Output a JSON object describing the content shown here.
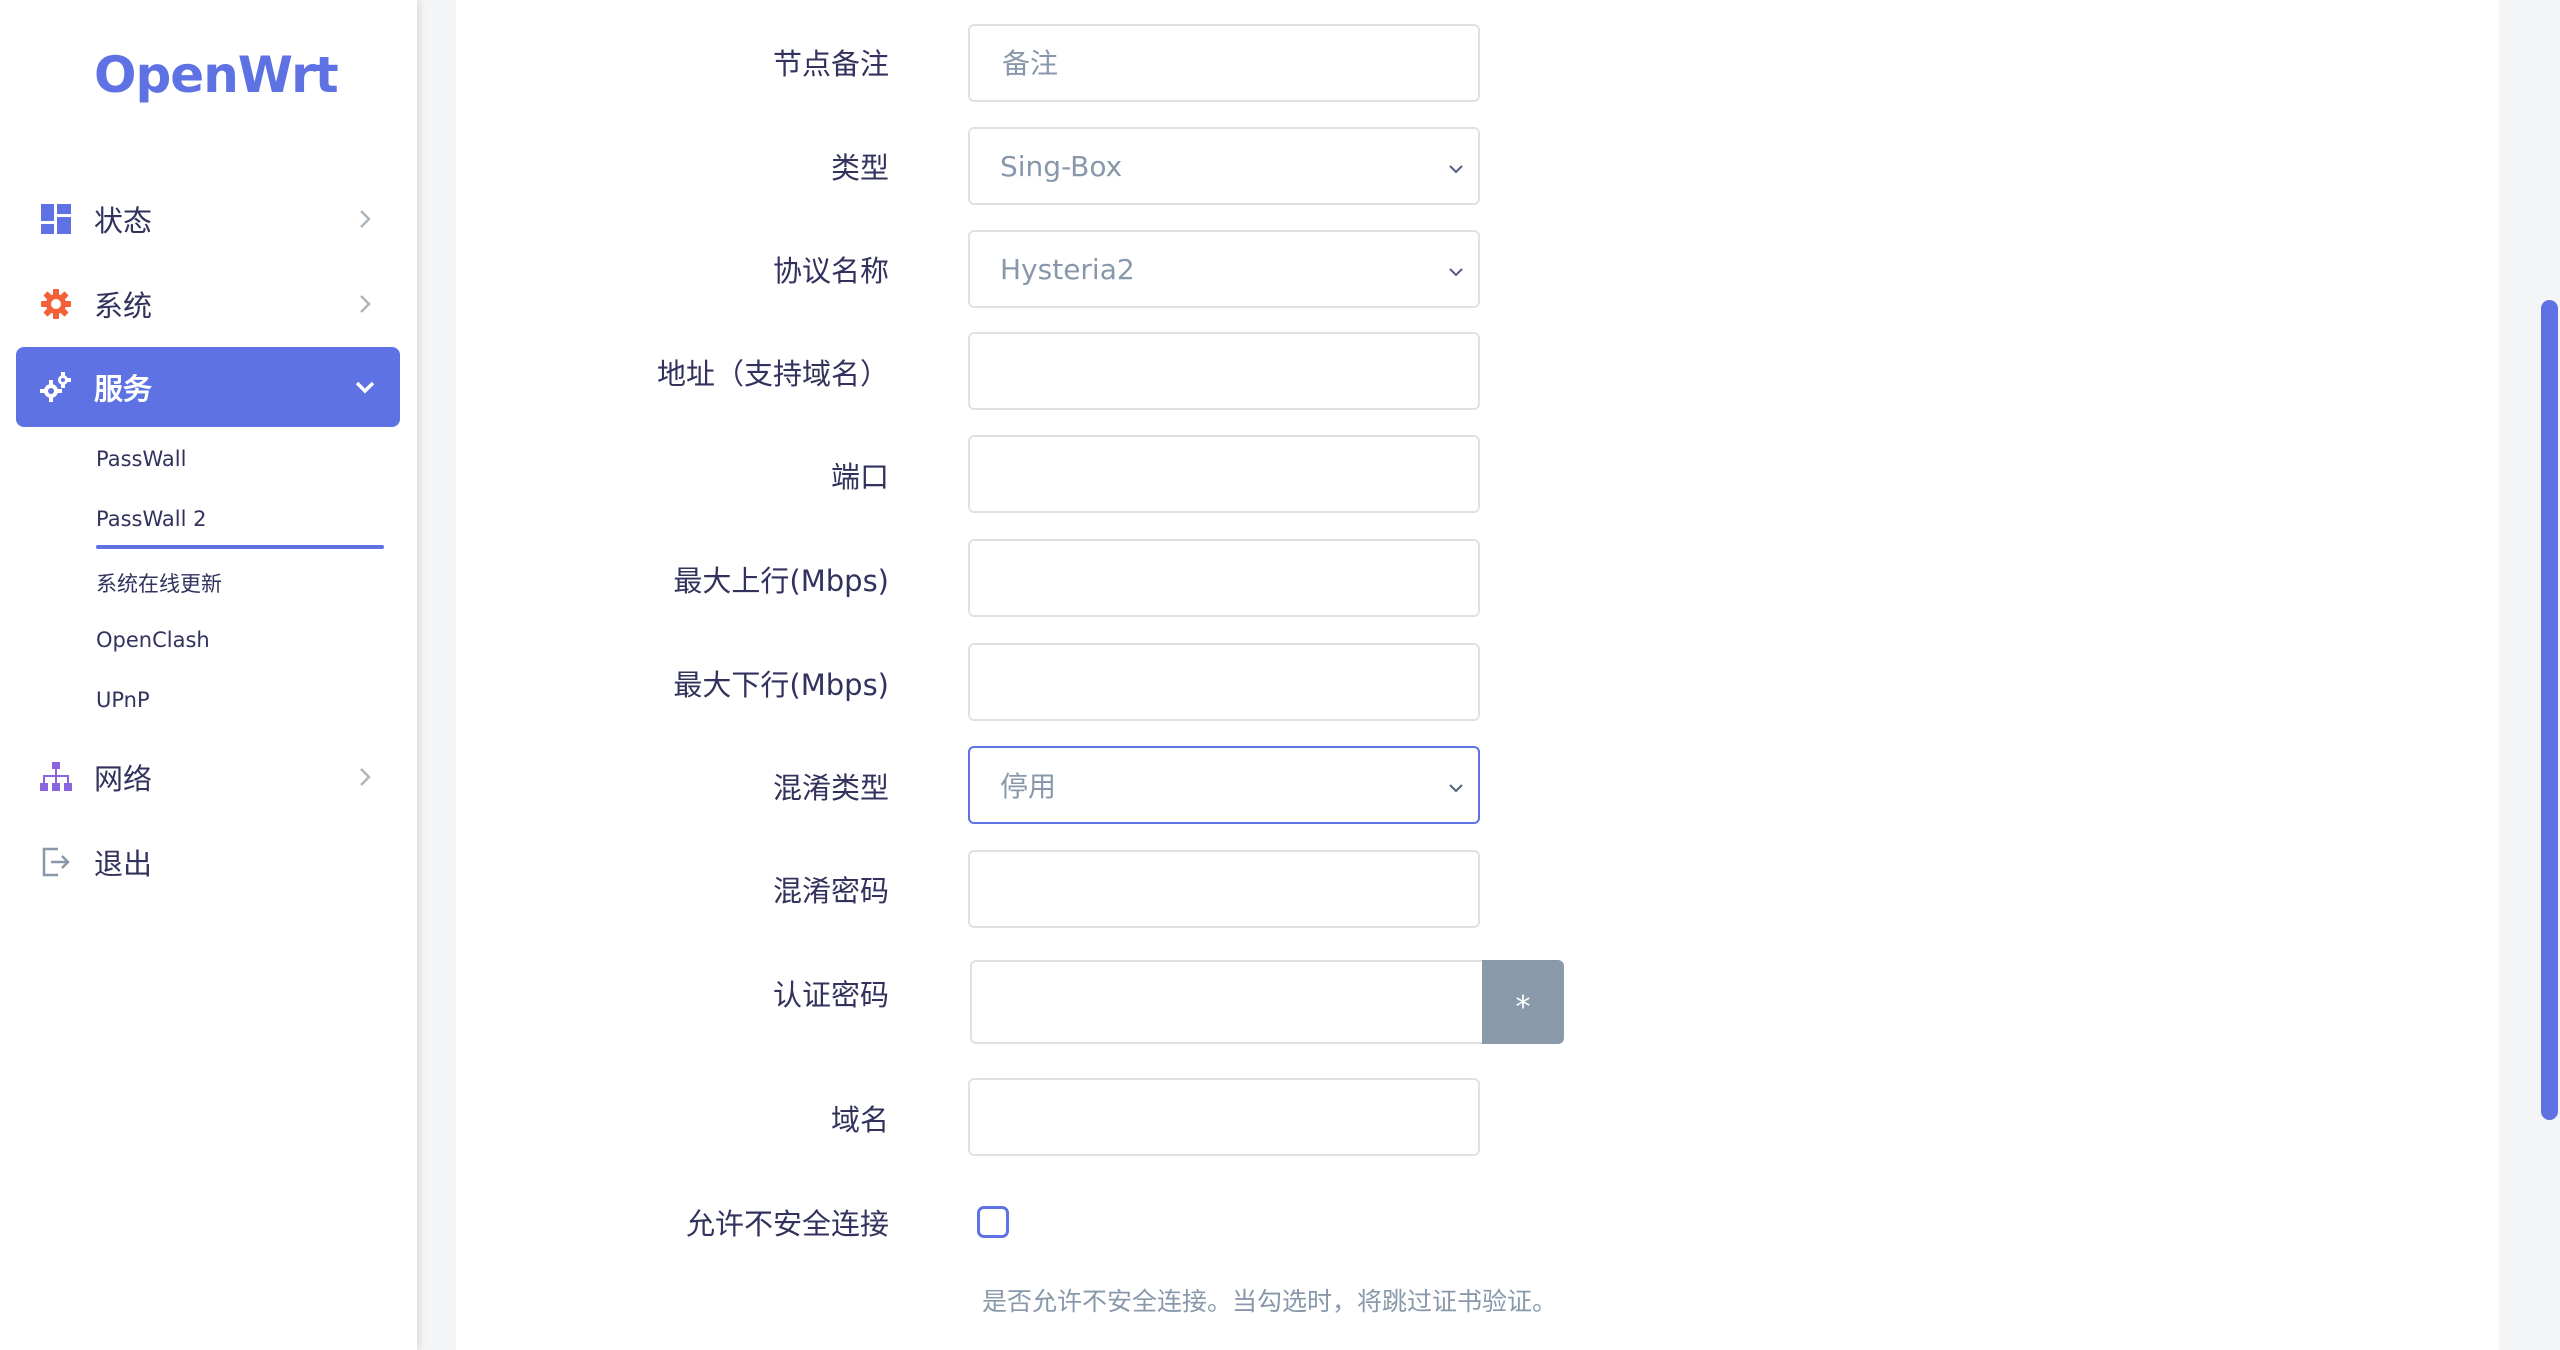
{
  "brand": {
    "logo_text": "OpenWrt",
    "accent": "#5e72e4"
  },
  "sidebar": {
    "items": [
      {
        "label": "状态",
        "icon": "dashboard-icon"
      },
      {
        "label": "系统",
        "icon": "gear-icon"
      },
      {
        "label": "服务",
        "icon": "gears-icon",
        "active": true
      },
      {
        "label": "网络",
        "icon": "sitemap-icon"
      },
      {
        "label": "退出",
        "icon": "logout-icon"
      }
    ],
    "sub_items": [
      "PassWall",
      "PassWall 2",
      "系统在线更新",
      "OpenClash",
      "UPnP"
    ],
    "active_sub_item": "PassWall 2"
  },
  "form": {
    "remarks": {
      "label": "节点备注",
      "placeholder": "备注"
    },
    "type": {
      "label": "类型",
      "value": "Sing-Box"
    },
    "protocol": {
      "label": "协议名称",
      "value": "Hysteria2"
    },
    "address": {
      "label": "地址（支持域名）",
      "value": ""
    },
    "port": {
      "label": "端口",
      "value": ""
    },
    "up_mbps": {
      "label": "最大上行(Mbps)",
      "value": ""
    },
    "down_mbps": {
      "label": "最大下行(Mbps)",
      "value": ""
    },
    "obfs_type": {
      "label": "混淆类型",
      "value": "停用"
    },
    "obfs_password": {
      "label": "混淆密码",
      "value": ""
    },
    "auth_password": {
      "label": "认证密码",
      "value": "",
      "reveal_button": "*"
    },
    "domain": {
      "label": "域名",
      "value": ""
    },
    "insecure": {
      "label": "允许不安全连接",
      "checked": false,
      "help": "是否允许不安全连接。当勾选时，将跳过证书验证。"
    }
  }
}
